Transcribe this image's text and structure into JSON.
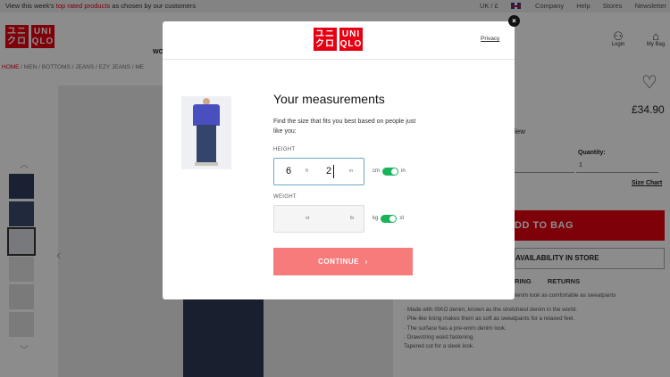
{
  "topbar": {
    "promo_before": "View this week's ",
    "promo_link": "top rated products",
    "promo_after": " as chosen by our customers",
    "locale": "UK / £",
    "links": [
      "Company",
      "Help",
      "Stores",
      "Newsletter"
    ]
  },
  "brand": {
    "line1": "ユニ",
    "line2": "クロ",
    "line3": "UNI",
    "line4": "QLO",
    "color": "#e60012"
  },
  "header": {
    "nav_partial": "WO",
    "login_label": "Login",
    "bag_label": "My Bag",
    "bag_count": "0"
  },
  "breadcrumb": [
    "HOME",
    "MEN",
    "BOTTOMS",
    "JEANS",
    "EZY JEANS",
    "ME"
  ],
  "product": {
    "price": "£34.90",
    "review_partial": "view",
    "quantity_label": "Quantity:",
    "quantity_value": "1",
    "size_chart": "Size Chart",
    "add_to_bag": "DD TO BAG",
    "availability": "AVAILABILITY IN STORE",
    "tabs": [
      "RING",
      "RETURNS"
    ],
    "desc_partial": "denim look as comfortable as sweatpants",
    "bullets": [
      "· Made with ISKO denim, known as the stretchiest denim in the world.",
      "· Pile-like lining makes them as soft as sweatpants for a relaxed feel.",
      "· The surface has a pre-worn denim look.",
      "· Drawstring waist fastening.",
      "Tapered cut for a sleek look."
    ]
  },
  "modal": {
    "privacy": "Privacy",
    "close": "×",
    "title": "Your measurements",
    "description": "Find the size that fits you best based on people just like you:",
    "height": {
      "label": "HEIGHT",
      "ft_value": "6",
      "ft_unit": "ft",
      "in_value": "2",
      "in_unit": "in",
      "toggle_left": "cm",
      "toggle_right": "in",
      "toggle_on": true
    },
    "weight": {
      "label": "WEIGHT",
      "st_unit": "st",
      "lb_unit": "lb",
      "toggle_left": "kg",
      "toggle_right": "st",
      "toggle_on": true
    },
    "continue_label": "CONTINUE"
  },
  "colors": {
    "accent": "#e60012",
    "toggle": "#19b35b",
    "continue_bg": "#f77b7b",
    "focus": "#6aa7c9"
  },
  "icons": [
    "chevron-up-icon",
    "chevron-down-icon",
    "chevron-left-icon",
    "heart-icon",
    "user-icon",
    "bag-icon",
    "close-icon",
    "chevron-right-icon"
  ]
}
